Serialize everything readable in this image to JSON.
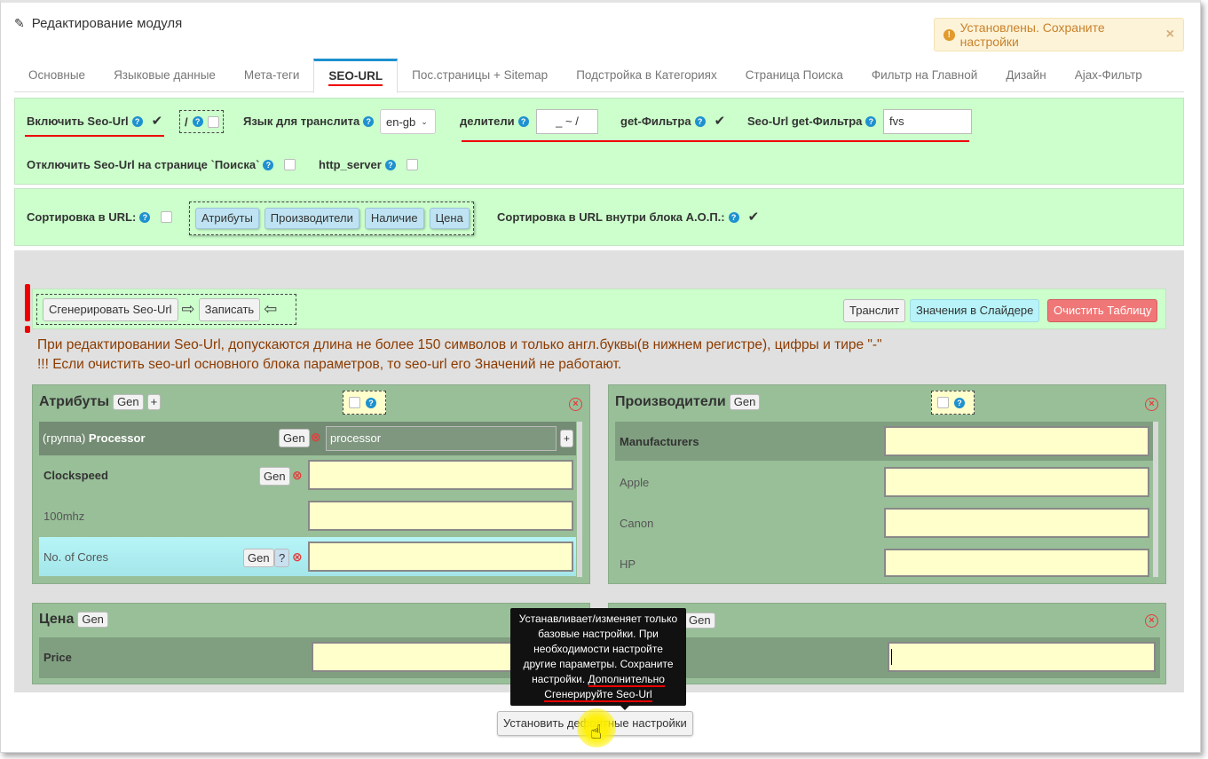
{
  "header": {
    "title": "Редактирование модуля"
  },
  "alert": {
    "text": "Установлены. Сохраните настройки",
    "close": "×",
    "icon": "!"
  },
  "tabs": [
    {
      "label": "Основные"
    },
    {
      "label": "Языковые данные"
    },
    {
      "label": "Мета-теги"
    },
    {
      "label": "SEO-URL"
    },
    {
      "label": "Пос.страницы + Sitemap"
    },
    {
      "label": "Подстройка в Категориях"
    },
    {
      "label": "Страница Поиска"
    },
    {
      "label": "Фильтр на Главной"
    },
    {
      "label": "Дизайн"
    },
    {
      "label": "Ajax-Фильтр"
    }
  ],
  "settings": {
    "enable_seo_label": "Включить Seo-Url",
    "slash_label": "/",
    "translit_lang_label": "Язык для транслита",
    "translit_lang_value": "en-gb",
    "dividers_label": "делители",
    "dividers_value": "_ ~ /",
    "get_filter_label": "get-Фильтра",
    "seo_get_filter_label": "Seo-Url get-Фильтра",
    "seo_get_filter_value": "fvs",
    "disable_search_label": "Отключить Seo-Url на странице `Поиска`",
    "http_server_label": "http_server",
    "q": "?",
    "check": "✔"
  },
  "sorting": {
    "label": "Сортировка в URL:",
    "buttons": [
      "Атрибуты",
      "Производители",
      "Наличие",
      "Цена"
    ],
    "inner_label": "Сортировка в URL внутри блока А.О.П.:"
  },
  "toolbar": {
    "generate": "Сгенерировать Seo-Url",
    "save": "Записать",
    "arrow_right": "⇨",
    "arrow_left": "⇦",
    "translit": "Транслит",
    "slider_values": "Значения в Слайдере",
    "clear_table": "Очистить Таблицу"
  },
  "warnings": {
    "line1": "При редактировании Seo-Url, допускаются длина не более 150 символов и только англ.буквы(в нижнем регистре), цифры и тире \"-\"",
    "line2": "!!! Если очистить seo-url основного блока параметров, то seo-url его Значений не работают."
  },
  "attributes": {
    "title": "Атрибуты",
    "gen": "Gen",
    "plus": "+",
    "group_prefix": "(группа)",
    "group_name": "Processor",
    "group_value": "processor",
    "rows": [
      {
        "label": "Clockspeed",
        "bold": true,
        "gen": "Gen"
      },
      {
        "label": "100mhz"
      },
      {
        "label": "No. of Cores",
        "gen": "Gen",
        "q": "?"
      }
    ]
  },
  "manufacturers": {
    "title": "Производители",
    "gen": "Gen",
    "rows": [
      {
        "label": "Manufacturers"
      },
      {
        "label": "Apple"
      },
      {
        "label": "Canon"
      },
      {
        "label": "HP"
      }
    ]
  },
  "price": {
    "title": "Цена",
    "gen": "Gen",
    "row_label": "Price"
  },
  "stock": {
    "gen": "Gen"
  },
  "tooltip": {
    "text": "Устанавливает/изменяет только базовые настройки. При необходимости настройте другие параметры. Сохраните настройки.",
    "highlight": "Дополнительно Сгенерируйте Seo-Url"
  },
  "default_button": "Установить дефолтные настройки"
}
